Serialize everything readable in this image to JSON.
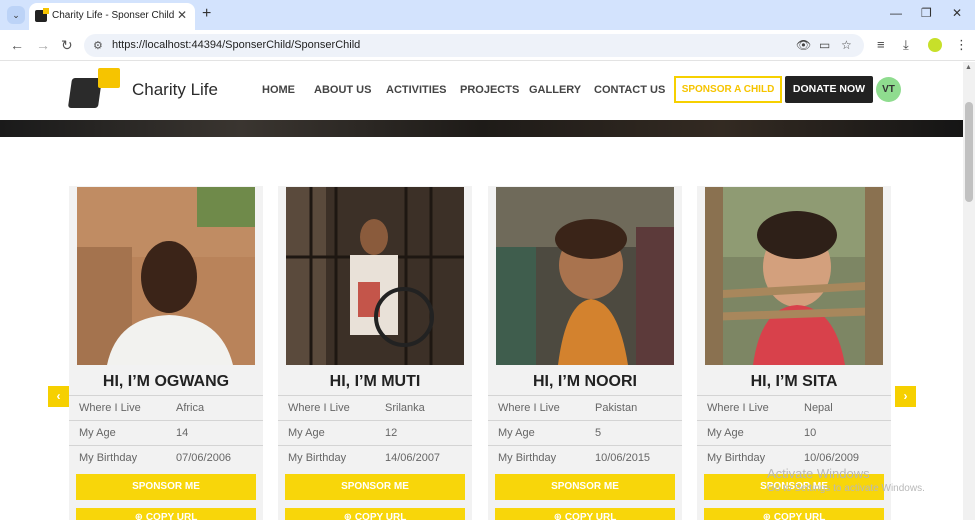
{
  "browser": {
    "tab_title": "Charity Life - Sponser Child",
    "url": "https://localhost:44394/SponserChild/SponserChild"
  },
  "site": {
    "logo_text": "Charity Life",
    "nav": [
      "HOME",
      "ABOUT US",
      "ACTIVITIES",
      "PROJECTS",
      "GALLERY",
      "CONTACT US"
    ],
    "sponsor_button": "SPONSOR A CHILD",
    "donate_button": "DONATE NOW",
    "user_initials": "VT"
  },
  "labels": {
    "where": "Where I Live",
    "age": "My Age",
    "birthday": "My Birthday",
    "sponsor_me": "SPONSOR ME",
    "copy_url": "⊕ COPY URL"
  },
  "children": [
    {
      "name": "HI, I’M OGWANG",
      "where": "Africa",
      "age": "14",
      "birthday": "07/06/2006"
    },
    {
      "name": "HI, I’M MUTI",
      "where": "Srilanka",
      "age": "12",
      "birthday": "14/06/2007"
    },
    {
      "name": "HI, I’M NOORI",
      "where": "Pakistan",
      "age": "5",
      "birthday": "10/06/2015"
    },
    {
      "name": "HI, I’M SITA",
      "where": "Nepal",
      "age": "10",
      "birthday": "10/06/2009"
    }
  ],
  "watermark": {
    "line1": "Activate Windows",
    "line2": "Go to Settings to activate Windows."
  }
}
